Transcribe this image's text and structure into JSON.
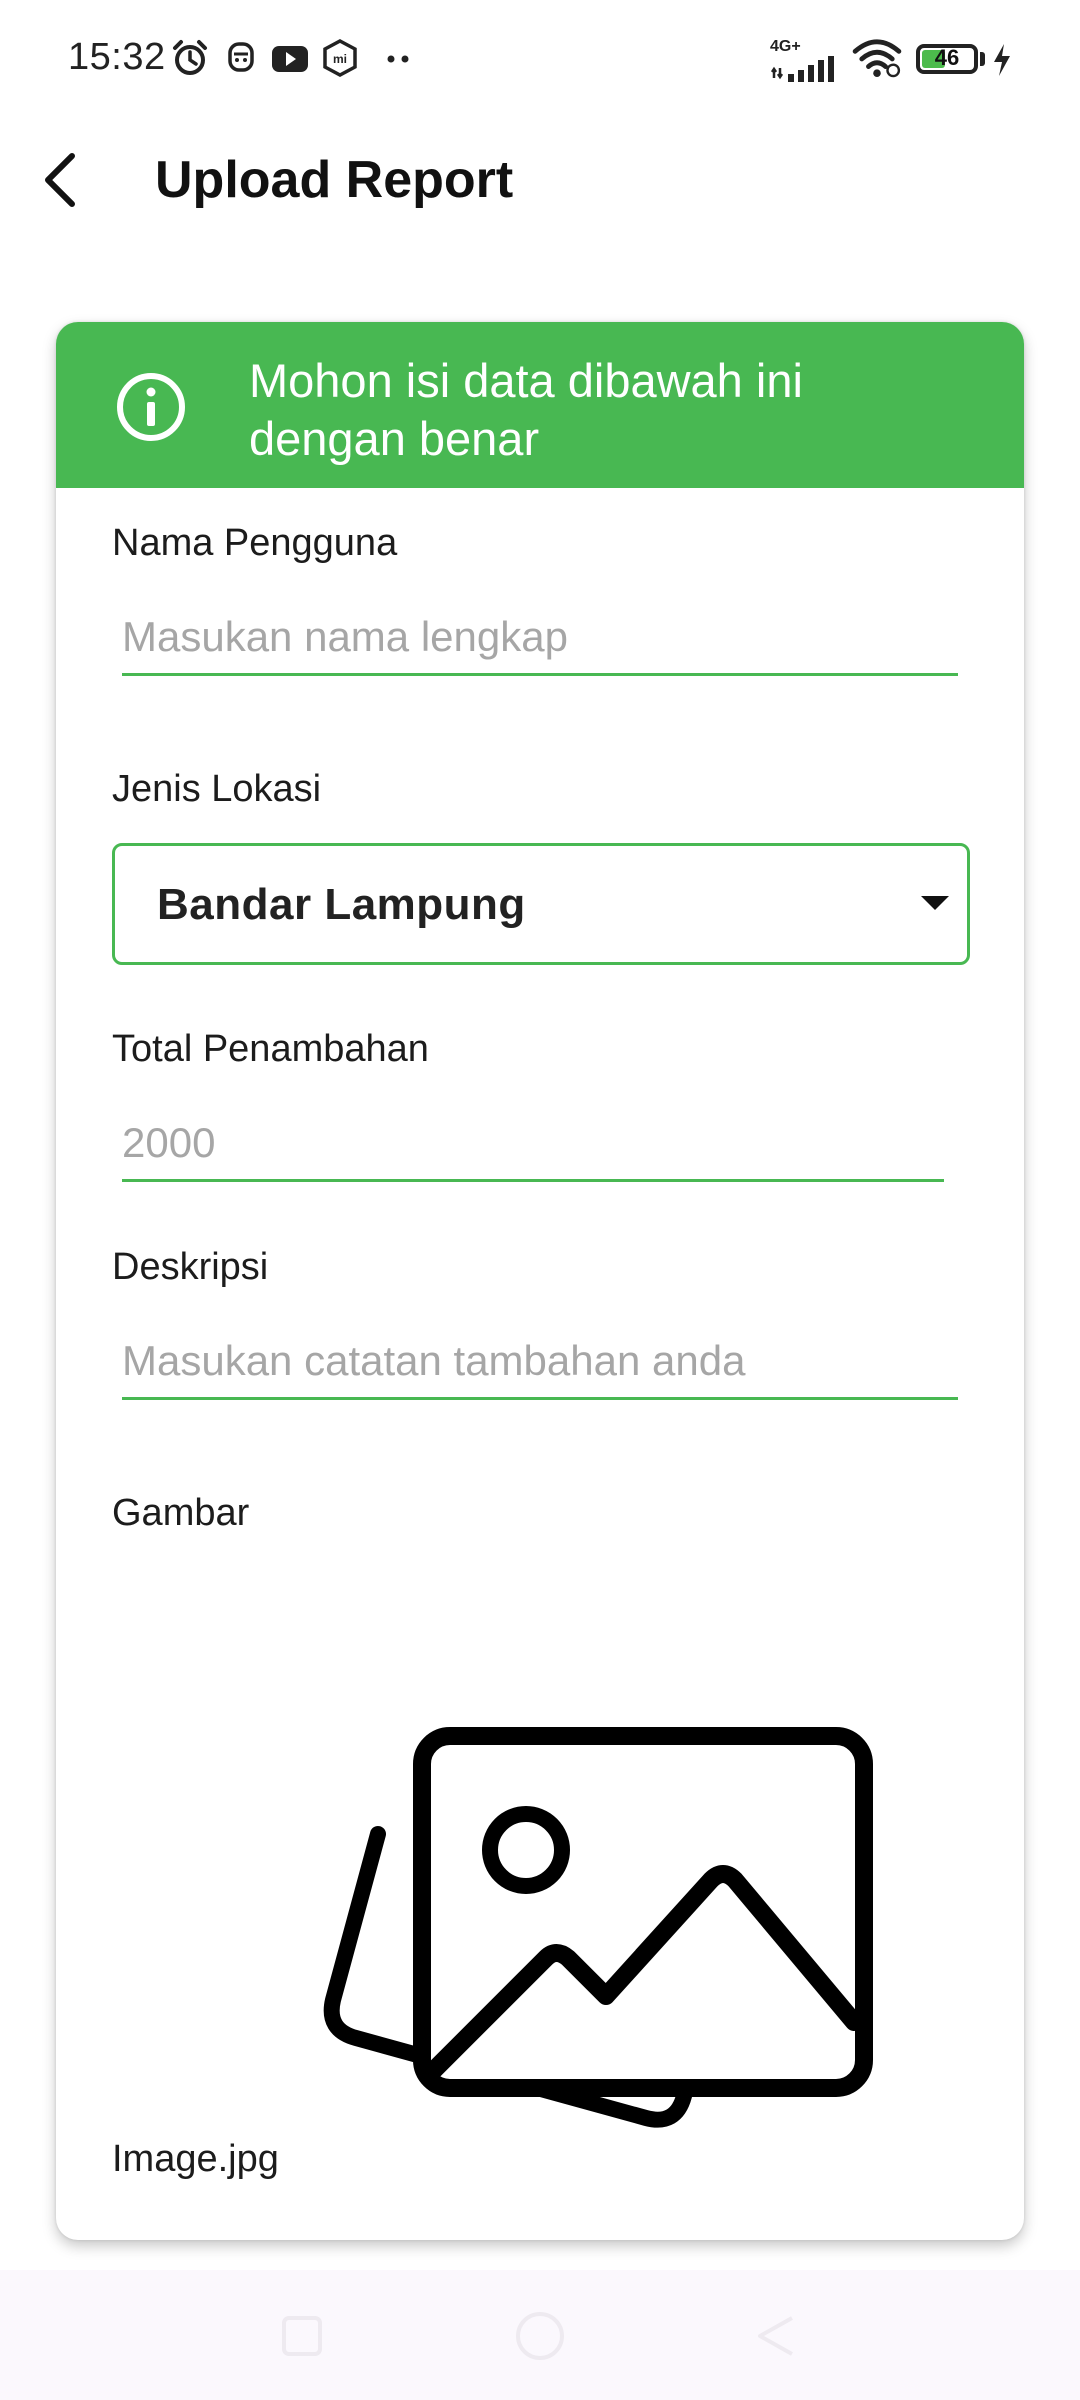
{
  "status_bar": {
    "time": "15:32",
    "network": "4G+",
    "battery": "46",
    "battery_level_percent": 46,
    "icons": [
      "alarm-icon",
      "notification-app-icon",
      "youtube-icon",
      "mi-icon",
      "more-dots-icon",
      "signal-icon",
      "wifi-icon",
      "battery-icon",
      "charging-icon"
    ]
  },
  "app_bar": {
    "title": "Upload Report",
    "back_icon": "arrow-back-icon"
  },
  "form": {
    "banner_text": "Mohon isi data dibawah ini dengan benar",
    "banner_icon": "info-icon",
    "name_label": "Nama Pengguna",
    "name_placeholder": "Masukan nama lengkap",
    "name_value": "",
    "location_label": "Jenis Lokasi",
    "location_value": "Bandar Lampung",
    "total_label": "Total Penambahan",
    "total_placeholder": "2000",
    "total_value": "",
    "description_label": "Deskripsi",
    "description_placeholder": "Masukan catatan tambahan anda",
    "description_value": "",
    "image_label": "Gambar",
    "image_icon": "image-gallery-icon",
    "image_filename": "Image.jpg"
  },
  "nav_bar": {
    "icons": [
      "recents-square-icon",
      "home-circle-icon",
      "back-triangle-icon"
    ]
  },
  "colors": {
    "accent": "#48B852",
    "background": "#FFFFFF",
    "placeholder": "#A6A6A6",
    "navbar": "#FBF8FD"
  }
}
